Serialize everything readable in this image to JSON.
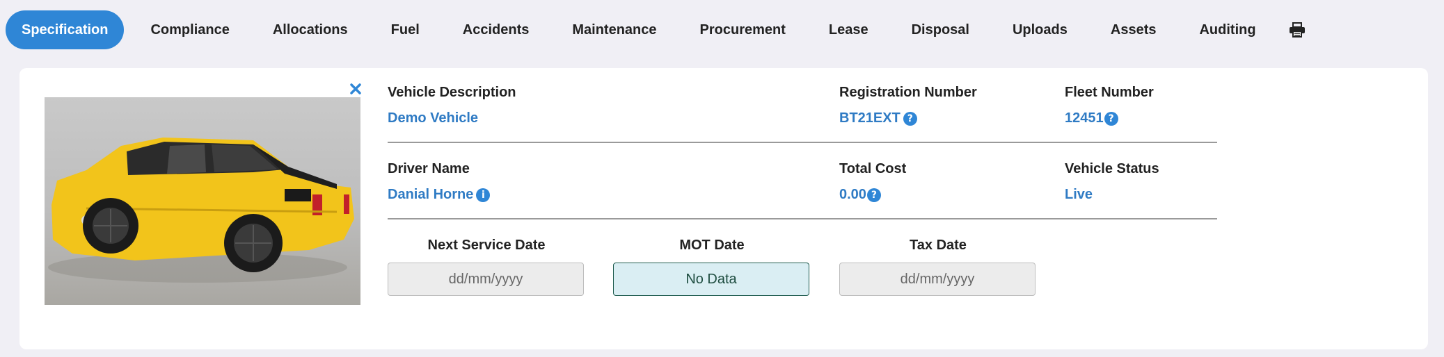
{
  "tabs": [
    {
      "label": "Specification",
      "active": true
    },
    {
      "label": "Compliance"
    },
    {
      "label": "Allocations"
    },
    {
      "label": "Fuel"
    },
    {
      "label": "Accidents"
    },
    {
      "label": "Maintenance"
    },
    {
      "label": "Procurement"
    },
    {
      "label": "Lease"
    },
    {
      "label": "Disposal"
    },
    {
      "label": "Uploads"
    },
    {
      "label": "Assets"
    },
    {
      "label": "Auditing"
    }
  ],
  "icons": {
    "print": "printer-icon",
    "close": "close-icon",
    "help": "question-circle-icon",
    "info": "info-circle-icon"
  },
  "colors": {
    "accent": "#2f86d6",
    "value_text": "#2f7bc4",
    "mot_bg": "#daeef3"
  },
  "vehicle": {
    "description_label": "Vehicle Description",
    "description_value": "Demo Vehicle",
    "registration_label": "Registration Number",
    "registration_value": "BT21EXT",
    "fleet_label": "Fleet Number",
    "fleet_value": "12451",
    "driver_label": "Driver Name",
    "driver_value": "Danial Horne",
    "cost_label": "Total Cost",
    "cost_value": "0.00",
    "status_label": "Vehicle Status",
    "status_value": "Live"
  },
  "dates": {
    "service_label": "Next Service Date",
    "service_placeholder": "dd/mm/yyyy",
    "mot_label": "MOT Date",
    "mot_value": "No Data",
    "tax_label": "Tax Date",
    "tax_placeholder": "dd/mm/yyyy"
  }
}
